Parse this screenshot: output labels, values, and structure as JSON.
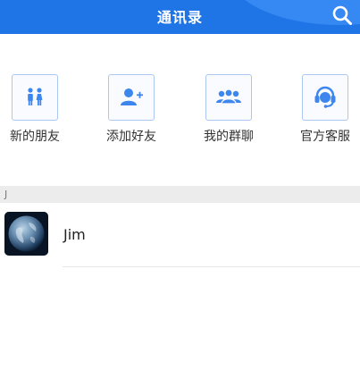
{
  "header": {
    "title": "通讯录",
    "search_icon": "search-icon"
  },
  "actions": [
    {
      "label": "新的朋友",
      "icon": "new-friends-icon"
    },
    {
      "label": "添加好友",
      "icon": "add-friend-icon"
    },
    {
      "label": "我的群聊",
      "icon": "group-chat-icon"
    },
    {
      "label": "官方客服",
      "icon": "customer-service-icon"
    }
  ],
  "sections": [
    {
      "letter": "J",
      "contacts": [
        {
          "name": "Jim",
          "avatar": "earth-avatar"
        }
      ]
    }
  ],
  "colors": {
    "primary": "#1f74e6",
    "icon": "#3d86ee",
    "section_bg": "#ececec"
  }
}
